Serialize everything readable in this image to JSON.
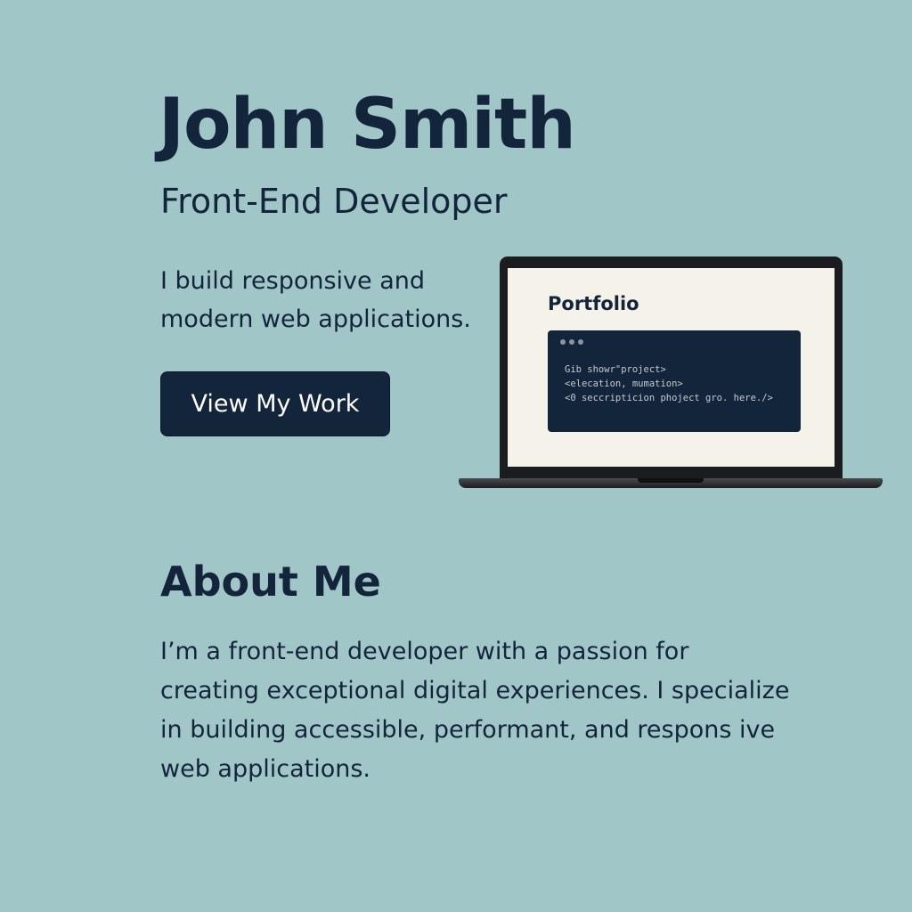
{
  "hero": {
    "name": "John Smith",
    "role": "Front-End Developer",
    "tagline": "I build responsive and modern web applications.",
    "cta_label": "View My Work"
  },
  "mockup": {
    "screen_title": "Portfolio",
    "code_lines": [
      "Gib showr\"project>",
      "<elecation, mumation>",
      "<0 seccripticion phoject gro. here./>"
    ]
  },
  "about": {
    "heading": "About Me",
    "body": "I’m a front-end developer with a passion for creating exceptional digital experiences. I specialize in building accessible, performant, and respons ive web applications."
  },
  "colors": {
    "background": "#a0c6c8",
    "text": "#13253a",
    "button_bg": "#13253a",
    "button_text": "#ffffff",
    "screen_bg": "#f5f2ea"
  },
  "icons": {
    "window_controls": "three-dots-icon"
  }
}
